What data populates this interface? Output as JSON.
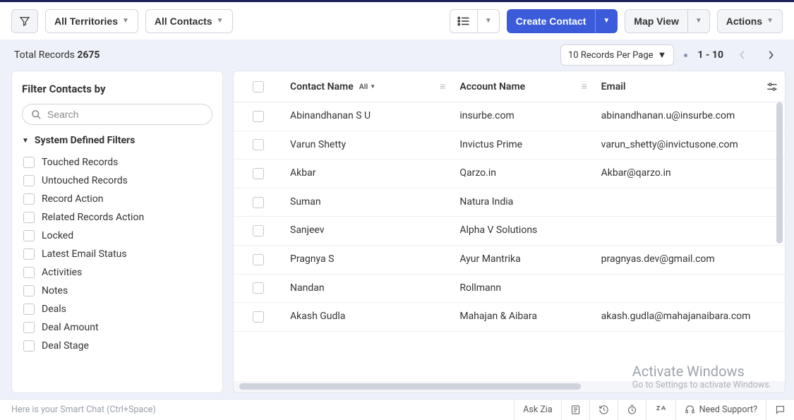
{
  "toolbar": {
    "territories_label": "All Territories",
    "contacts_scope_label": "All Contacts",
    "create_label": "Create Contact",
    "map_view_label": "Map View",
    "actions_label": "Actions"
  },
  "summary": {
    "total_label": "Total Records",
    "total_count": "2675",
    "per_page_label": "10 Records Per Page",
    "range": "1 - 10"
  },
  "sidebar": {
    "title": "Filter Contacts by",
    "search_placeholder": "Search",
    "section_system": "System Defined Filters",
    "filters": [
      "Touched Records",
      "Untouched Records",
      "Record Action",
      "Related Records Action",
      "Locked",
      "Latest Email Status",
      "Activities",
      "Notes",
      "Deals",
      "Deal Amount",
      "Deal Stage"
    ]
  },
  "table": {
    "headers": {
      "contact_name": "Contact Name",
      "all_tag": "All",
      "account_name": "Account Name",
      "email": "Email"
    },
    "rows": [
      {
        "contact": "Abinandhanan S U",
        "account": "insurbe.com",
        "email": "abinandhanan.u@insurbe.com"
      },
      {
        "contact": "Varun Shetty",
        "account": "Invictus Prime",
        "email": "varun_shetty@invictusone.com"
      },
      {
        "contact": "Akbar",
        "account": "Qarzo.in",
        "email": "Akbar@qarzo.in"
      },
      {
        "contact": "Suman",
        "account": "Natura India",
        "email": ""
      },
      {
        "contact": "Sanjeev",
        "account": "Alpha V Solutions",
        "email": ""
      },
      {
        "contact": "Pragnya S",
        "account": "Ayur Mantrika",
        "email": "pragnyas.dev@gmail.com"
      },
      {
        "contact": "Nandan",
        "account": "Rollmann",
        "email": ""
      },
      {
        "contact": "Akash Gudla",
        "account": "Mahajan & Aibara",
        "email": "akash.gudla@mahajanaibara.com"
      }
    ]
  },
  "footer": {
    "smart_chat": "Here is your Smart Chat (Ctrl+Space)",
    "ask_zia": "Ask Zia",
    "need_support": "Need Support?"
  },
  "watermark": {
    "t1": "Activate Windows",
    "t2": "Go to Settings to activate Windows."
  }
}
